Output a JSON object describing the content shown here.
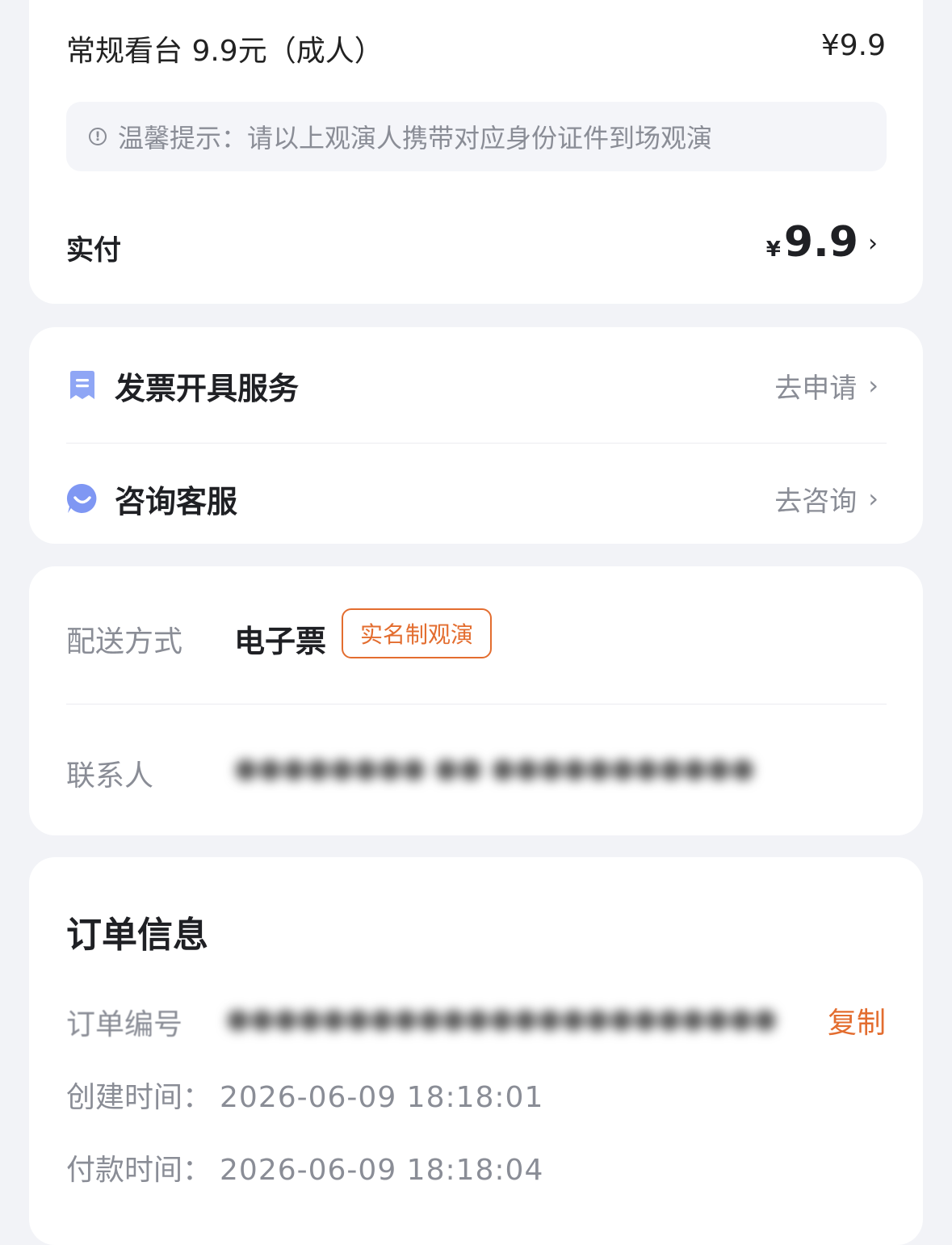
{
  "price_card": {
    "ticket_name": "常规看台 9.9元（成人）",
    "ticket_price": "¥9.9",
    "tip": "温馨提示：请以上观演人携带对应身份证件到场观演",
    "paid_label": "实付",
    "paid_currency": "¥",
    "paid_value": "9.9"
  },
  "service_card": {
    "invoice_label": "发票开具服务",
    "invoice_action": "去申请",
    "consult_label": "咨询客服",
    "consult_action": "去咨询"
  },
  "delivery_card": {
    "delivery_label": "配送方式",
    "delivery_value": "电子票",
    "realname_tag": "实名制观演",
    "contact_label": "联系人"
  },
  "order_card": {
    "title": "订单信息",
    "order_no_label": "订单编号",
    "copy_label": "复制",
    "created_label": "创建时间：",
    "created_value": "2026-06-09 18:18:01",
    "paid_label": "付款时间：",
    "paid_value": "2026-06-09 18:18:04"
  },
  "colors": {
    "accent_orange": "#e36d2f",
    "invoice_icon": "#8fa6f5",
    "consult_icon": "#7f97f3",
    "muted_text": "#8a8d96"
  },
  "icons": {
    "tip": "info-circle-icon",
    "invoice": "receipt-icon",
    "consult": "chat-smile-icon",
    "chevron": "chevron-right-icon"
  }
}
